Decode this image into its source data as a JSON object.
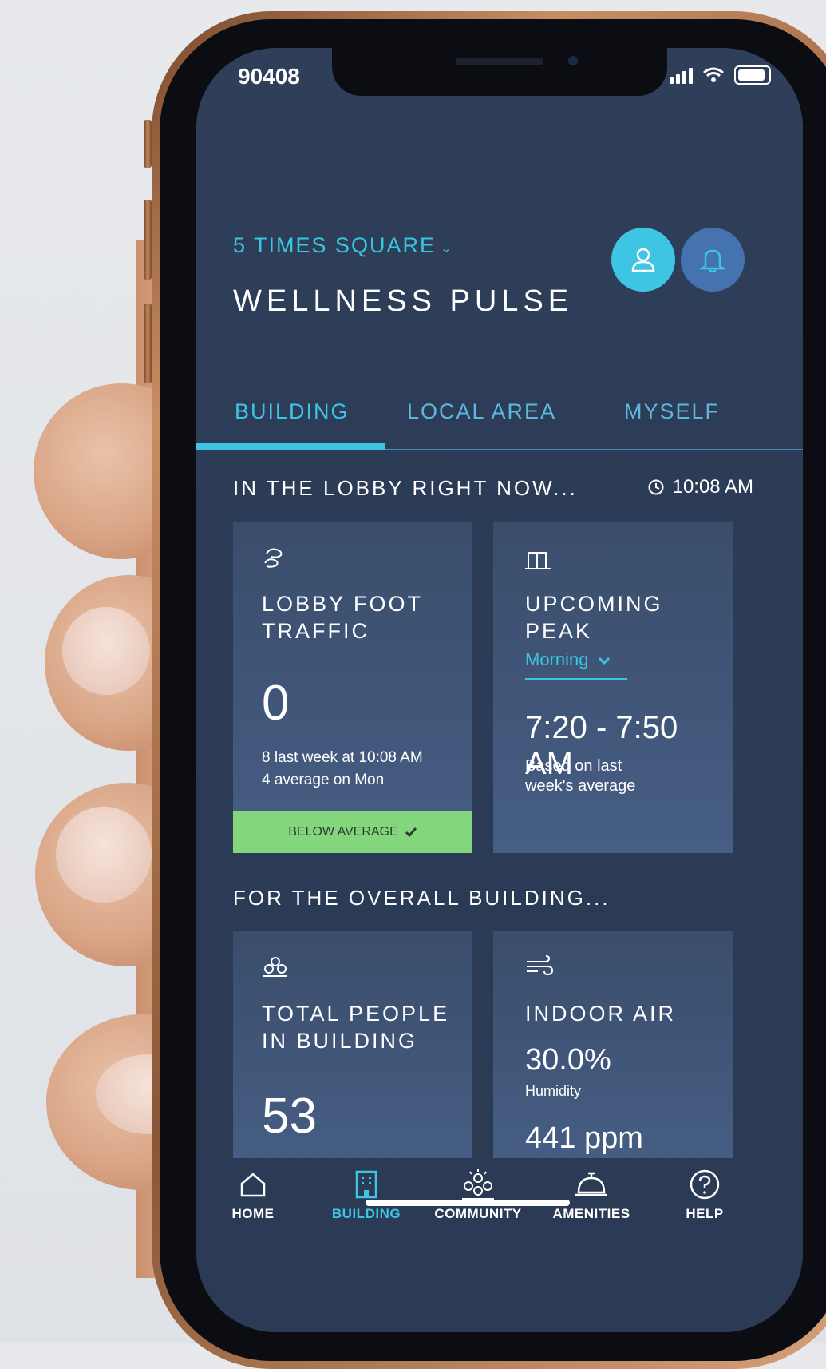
{
  "status_bar": {
    "time": "90408"
  },
  "header": {
    "location": "5 TIMES SQUARE",
    "location_chevron": "⌄",
    "title": "WELLNESS PULSE",
    "profile_icon": "person-icon",
    "bell_icon": "bell-icon"
  },
  "tabs": [
    {
      "label": "BUILDING",
      "active": true
    },
    {
      "label": "LOCAL AREA",
      "active": false
    },
    {
      "label": "MYSELF",
      "active": false
    }
  ],
  "lobby": {
    "heading": "IN THE LOBBY RIGHT NOW...",
    "time": "10:08 AM",
    "foot_traffic": {
      "label_line1": "LOBBY FOOT",
      "label_line2": "TRAFFIC",
      "value": "0",
      "line1": "8 last week at 10:08 AM",
      "line2": "4 average on Mon",
      "badge": "BELOW AVERAGE",
      "badge_icon": "check-icon"
    },
    "upcoming_peak": {
      "label_line1": "UPCOMING",
      "label_line2": "PEAK",
      "dropdown_value": "Morning",
      "range": "7:20 - 7:50 AM",
      "note_line1": "Based on last",
      "note_line2": "week's average"
    }
  },
  "building": {
    "heading": "FOR THE OVERALL BUILDING...",
    "total_people": {
      "label_line1": "TOTAL PEOPLE",
      "label_line2": "IN BUILDING",
      "value": "53"
    },
    "indoor_air": {
      "label": "INDOOR AIR",
      "humidity_value": "30.0%",
      "humidity_label": "Humidity",
      "co2_value": "441 ppm"
    }
  },
  "bottom_nav": [
    {
      "label": "HOME",
      "icon": "home-icon",
      "active": false
    },
    {
      "label": "BUILDING",
      "icon": "building-icon",
      "active": true
    },
    {
      "label": "COMMUNITY",
      "icon": "community-icon",
      "active": false
    },
    {
      "label": "AMENITIES",
      "icon": "amenities-icon",
      "active": false
    },
    {
      "label": "HELP",
      "icon": "help-icon",
      "active": false
    }
  ],
  "colors": {
    "accent": "#3ec5e3",
    "background": "#2f3f59",
    "badge_green": "#84d67d",
    "bell_button": "#4473b0"
  }
}
